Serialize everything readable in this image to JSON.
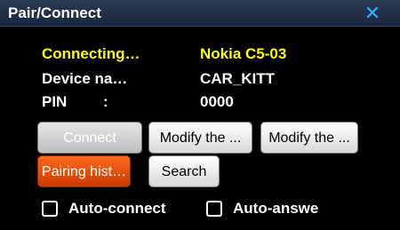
{
  "window": {
    "title": "Pair/Connect",
    "close_glyph": "✕"
  },
  "info": {
    "status_label": "Connecting…",
    "status_value": "Nokia C5-03",
    "device_label": "Device na…",
    "device_value": "CAR_KITT",
    "pin_label": "PIN",
    "pin_colon": ":",
    "pin_value": "0000"
  },
  "buttons": {
    "connect": "Connect",
    "modify1": "Modify the ...",
    "modify2": "Modify the ...",
    "pairing_history": "Pairing hist…",
    "search": "Search"
  },
  "checkboxes": {
    "auto_connect": {
      "label": "Auto-connect",
      "checked": false
    },
    "auto_answer": {
      "label": "Auto-answe",
      "checked": false
    }
  },
  "colors": {
    "accent_yellow": "#ffff00",
    "close_blue": "#27b5ff",
    "orange_button": "#ff6a1a"
  }
}
